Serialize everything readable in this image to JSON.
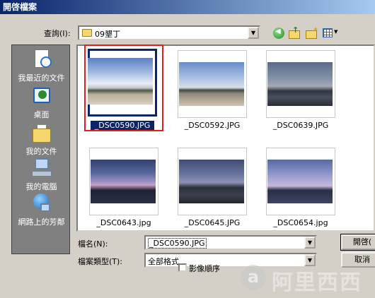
{
  "window": {
    "title": "開啓檔案"
  },
  "toolbar": {
    "look_in_label": "查詢(I):",
    "look_in_value": "09墾丁"
  },
  "places": [
    {
      "label": "我最近的文件"
    },
    {
      "label": "桌面"
    },
    {
      "label": "我的文件"
    },
    {
      "label": "我的電腦"
    },
    {
      "label": "網路上的芳鄰"
    }
  ],
  "files": [
    {
      "name": "_DSC0590.JPG",
      "selected": true
    },
    {
      "name": "_DSC0592.JPG"
    },
    {
      "name": "_DSC0639.JPG"
    },
    {
      "name": "_DSC0643.jpg"
    },
    {
      "name": "_DSC0645.JPG"
    },
    {
      "name": "_DSC0654.jpg"
    }
  ],
  "form": {
    "filename_label": "檔名(N):",
    "filename_value": "_DSC0590.JPG",
    "filetype_label": "檔案類型(T):",
    "filetype_value": "全部格式",
    "open_label": "開啓(",
    "cancel_label": "取消",
    "image_sequence_label": "影像順序"
  },
  "watermark": {
    "logo": "a",
    "text": "阿里西西"
  }
}
